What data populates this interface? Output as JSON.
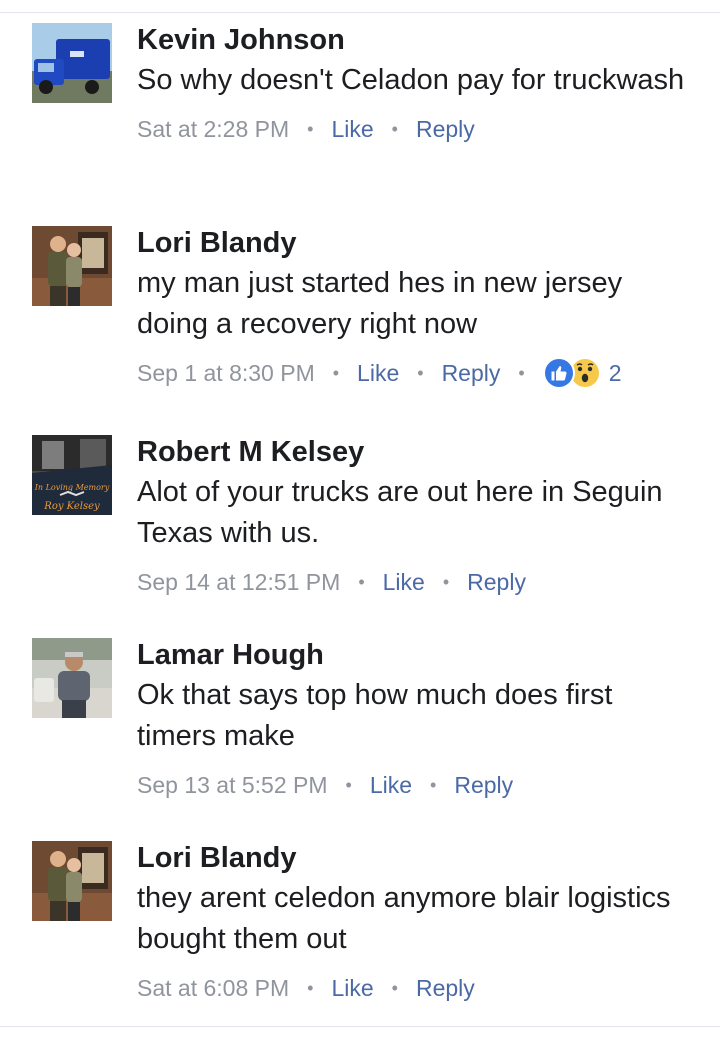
{
  "comments": [
    {
      "author": "Kevin Johnson",
      "text": "So why doesn't Celadon pay for truckwash",
      "time": "Sat at 2:28 PM",
      "like_label": "Like",
      "reply_label": "Reply"
    },
    {
      "author": "Lori Blandy",
      "text": "my man just started hes in new jersey doing a recovery right now",
      "time": "Sep 1 at 8:30 PM",
      "like_label": "Like",
      "reply_label": "Reply",
      "reactions": {
        "icons": [
          "like-icon",
          "wow-icon"
        ],
        "count": "2",
        "colors": {
          "like": "#3578e5",
          "wow": "#f7c94b"
        }
      }
    },
    {
      "author": "Robert M Kelsey",
      "text": "Alot of your trucks are out here in Seguin Texas with us.",
      "time": "Sep 14 at 12:51 PM",
      "like_label": "Like",
      "reply_label": "Reply",
      "avatar_text": [
        "In Loving Memory",
        "Roy Kelsey"
      ]
    },
    {
      "author": "Lamar Hough",
      "text": "Ok that says top how much does first timers make",
      "time": "Sep 13 at 5:52 PM",
      "like_label": "Like",
      "reply_label": "Reply"
    },
    {
      "author": "Lori Blandy",
      "text": "they arent celedon anymore blair logistics bought them out",
      "time": "Sat at 6:08 PM",
      "like_label": "Like",
      "reply_label": "Reply"
    }
  ],
  "colors": {
    "name": "#1c1e21",
    "meta": "#90949c",
    "action": "#4b6aa5"
  }
}
